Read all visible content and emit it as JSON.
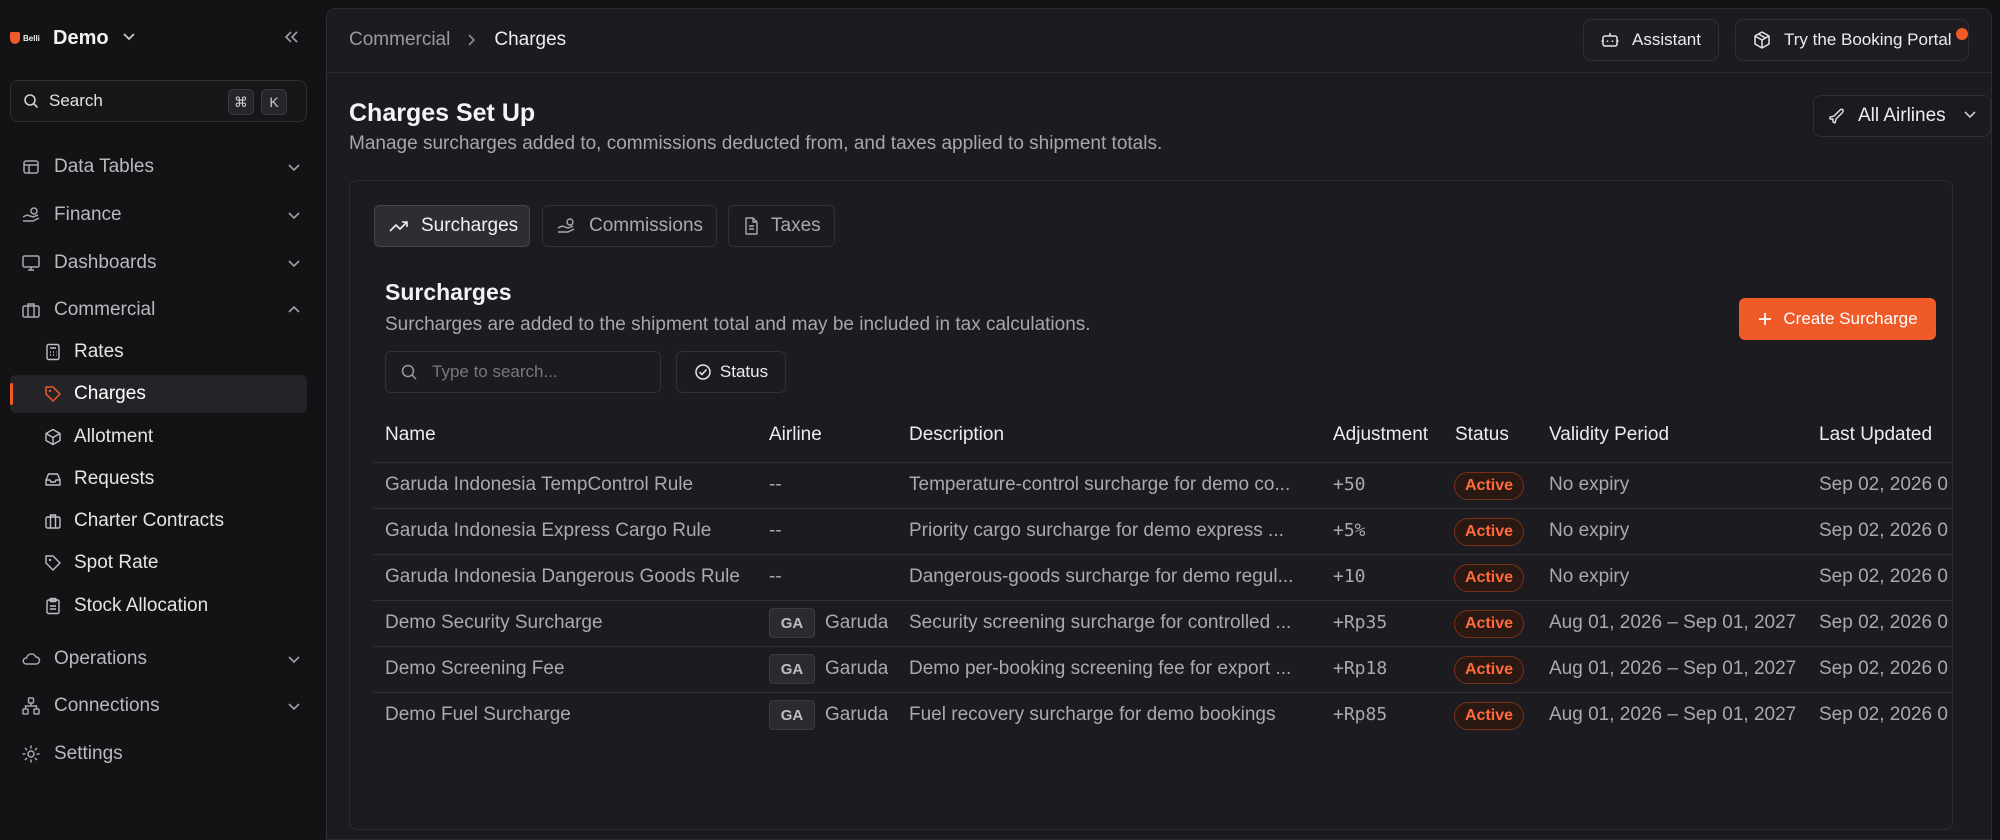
{
  "colors": {
    "accent": "#f05a28",
    "background": "#131316",
    "panel": "#1c1c20"
  },
  "sidebar": {
    "logo_text": "Belli",
    "workspace": "Demo",
    "search_label": "Search",
    "search_shortcut": [
      "⌘",
      "K"
    ],
    "items": [
      {
        "label": "Data Tables",
        "icon": "table-icon",
        "expanded": false
      },
      {
        "label": "Finance",
        "icon": "hand-coins-icon",
        "expanded": false
      },
      {
        "label": "Dashboards",
        "icon": "monitor-icon",
        "expanded": false
      },
      {
        "label": "Commercial",
        "icon": "briefcase-icon",
        "expanded": true
      },
      {
        "label": "Operations",
        "icon": "cloud-icon",
        "expanded": false
      },
      {
        "label": "Connections",
        "icon": "network-icon",
        "expanded": false
      },
      {
        "label": "Settings",
        "icon": "gear-icon"
      }
    ],
    "commercial_children": [
      {
        "label": "Rates",
        "icon": "calculator-icon"
      },
      {
        "label": "Charges",
        "icon": "tag-icon",
        "active": true
      },
      {
        "label": "Allotment",
        "icon": "package-icon"
      },
      {
        "label": "Requests",
        "icon": "inbox-icon"
      },
      {
        "label": "Charter Contracts",
        "icon": "briefcase-icon"
      },
      {
        "label": "Spot Rate",
        "icon": "tag-icon"
      },
      {
        "label": "Stock Allocation",
        "icon": "clipboard-icon"
      }
    ]
  },
  "header": {
    "breadcrumb": [
      "Commercial",
      "Charges"
    ],
    "assistant_label": "Assistant",
    "portal_label": "Try the Booking Portal"
  },
  "page": {
    "title": "Charges Set Up",
    "subtitle": "Manage surcharges added to, commissions deducted from, and taxes applied to shipment totals.",
    "airline_filter": "All Airlines"
  },
  "tabs": [
    {
      "label": "Surcharges",
      "active": true
    },
    {
      "label": "Commissions"
    },
    {
      "label": "Taxes"
    }
  ],
  "section": {
    "title": "Surcharges",
    "subtitle": "Surcharges are added to the shipment total and may be included in tax calculations.",
    "create_label": "Create Surcharge",
    "search_placeholder": "Type to search...",
    "status_filter_label": "Status"
  },
  "table": {
    "columns": [
      "Name",
      "Airline",
      "Description",
      "Adjustment",
      "Status",
      "Validity Period",
      "Last Updated"
    ],
    "rows": [
      {
        "name": "Garuda Indonesia TempControl Rule",
        "airline_code": "",
        "airline": "--",
        "description": "Temperature-control surcharge for demo co...",
        "adjustment": "+50",
        "status": "Active",
        "validity": "No expiry",
        "updated": "Sep 02, 2026 0"
      },
      {
        "name": "Garuda Indonesia Express Cargo Rule",
        "airline_code": "",
        "airline": "--",
        "description": "Priority cargo surcharge for demo express ...",
        "adjustment": "+5%",
        "status": "Active",
        "validity": "No expiry",
        "updated": "Sep 02, 2026 0"
      },
      {
        "name": "Garuda Indonesia Dangerous Goods Rule",
        "airline_code": "",
        "airline": "--",
        "description": "Dangerous-goods surcharge for demo regul...",
        "adjustment": "+10",
        "status": "Active",
        "validity": "No expiry",
        "updated": "Sep 02, 2026 0"
      },
      {
        "name": "Demo Security Surcharge",
        "airline_code": "GA",
        "airline": "Garuda",
        "description": "Security screening surcharge for controlled ...",
        "adjustment": "+Rp35",
        "status": "Active",
        "validity": "Aug 01, 2026 – Sep 01, 2027",
        "updated": "Sep 02, 2026 0"
      },
      {
        "name": "Demo Screening Fee",
        "airline_code": "GA",
        "airline": "Garuda",
        "description": "Demo per-booking screening fee for export ...",
        "adjustment": "+Rp18",
        "status": "Active",
        "validity": "Aug 01, 2026 – Sep 01, 2027",
        "updated": "Sep 02, 2026 0"
      },
      {
        "name": "Demo Fuel Surcharge",
        "airline_code": "GA",
        "airline": "Garuda",
        "description": "Fuel recovery surcharge for demo bookings",
        "adjustment": "+Rp85",
        "status": "Active",
        "validity": "Aug 01, 2026 – Sep 01, 2027",
        "updated": "Sep 02, 2026 0"
      }
    ]
  }
}
